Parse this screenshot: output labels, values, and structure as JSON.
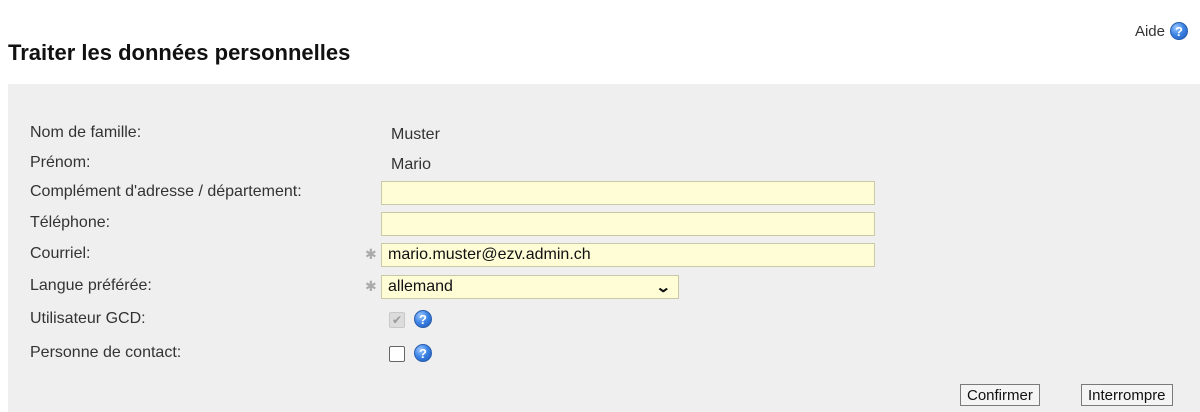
{
  "help": {
    "label": "Aide",
    "icon": "help-icon"
  },
  "page": {
    "title": "Traiter les données personnelles"
  },
  "form": {
    "last_name": {
      "label": "Nom de famille:",
      "value": "Muster"
    },
    "first_name": {
      "label": "Prénom:",
      "value": "Mario"
    },
    "address_complement": {
      "label": "Complément d'adresse / département:",
      "value": ""
    },
    "phone": {
      "label": "Téléphone:",
      "value": ""
    },
    "email": {
      "label": "Courriel:",
      "value": "mario.muster@ezv.admin.ch",
      "required": true
    },
    "language": {
      "label": "Langue préférée:",
      "selected": "allemand",
      "required": true
    },
    "gcd_user": {
      "label": "Utilisateur GCD:",
      "checked": true,
      "disabled": true
    },
    "contact_person": {
      "label": "Personne de contact:",
      "checked": false
    }
  },
  "buttons": {
    "confirm": "Confirmer",
    "cancel": "Interrompre"
  },
  "colors": {
    "field_bg": "#fffdd6",
    "panel_bg": "#efefef",
    "help_blue": "#3f86e6"
  }
}
